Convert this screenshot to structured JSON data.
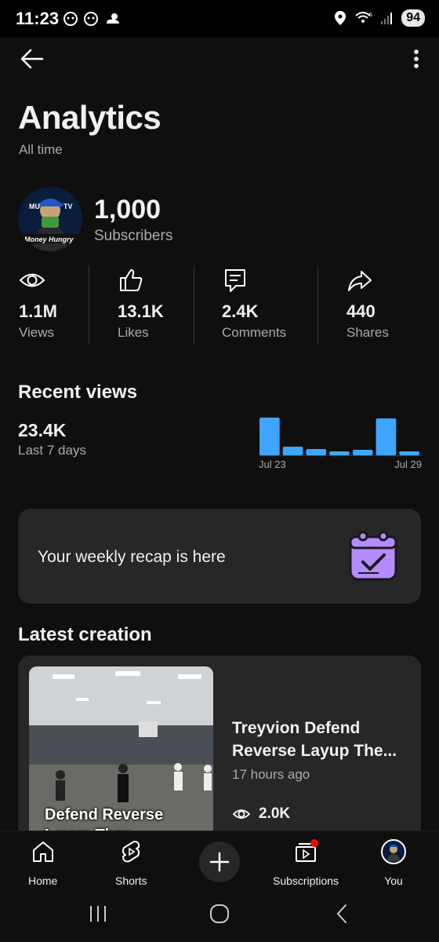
{
  "status_bar": {
    "time": "11:23",
    "battery": "94"
  },
  "header": {
    "title": "Analytics",
    "subtitle": "All time"
  },
  "channel": {
    "avatar_text": "MUN TV Money Hungry",
    "subscriber_count": "1,000",
    "subscriber_label": "Subscribers"
  },
  "stats": [
    {
      "icon": "eye-icon",
      "value": "1.1M",
      "label": "Views"
    },
    {
      "icon": "thumbs-up-icon",
      "value": "13.1K",
      "label": "Likes"
    },
    {
      "icon": "comment-icon",
      "value": "2.4K",
      "label": "Comments"
    },
    {
      "icon": "share-icon",
      "value": "440",
      "label": "Shares"
    }
  ],
  "recent_views": {
    "title": "Recent views",
    "value": "23.4K",
    "label": "Last 7 days",
    "start_label": "Jul 23",
    "end_label": "Jul 29"
  },
  "chart_data": {
    "type": "bar",
    "categories": [
      "Jul 23",
      "",
      "",
      "",
      "",
      "",
      "Jul 29"
    ],
    "values": [
      48,
      11,
      8,
      5,
      7,
      47,
      5
    ],
    "title": "",
    "xlabel": "",
    "ylabel": "",
    "color": "#3ea6ff"
  },
  "recap": {
    "text": "Your weekly recap is here"
  },
  "latest": {
    "title": "Latest creation",
    "video_title": "Treyvion Defend Reverse Layup The...",
    "time_ago": "17 hours ago",
    "views": "2.0K",
    "thumb_caption": "Defend Reverse Layup Then"
  },
  "nav": {
    "home": "Home",
    "shorts": "Shorts",
    "subscriptions": "Subscriptions",
    "you": "You"
  },
  "colors": {
    "background": "#0f0f0f",
    "card": "#272727",
    "accent": "#3ea6ff",
    "recap_purple": "#b48cff",
    "badge_red": "#ff0000"
  }
}
